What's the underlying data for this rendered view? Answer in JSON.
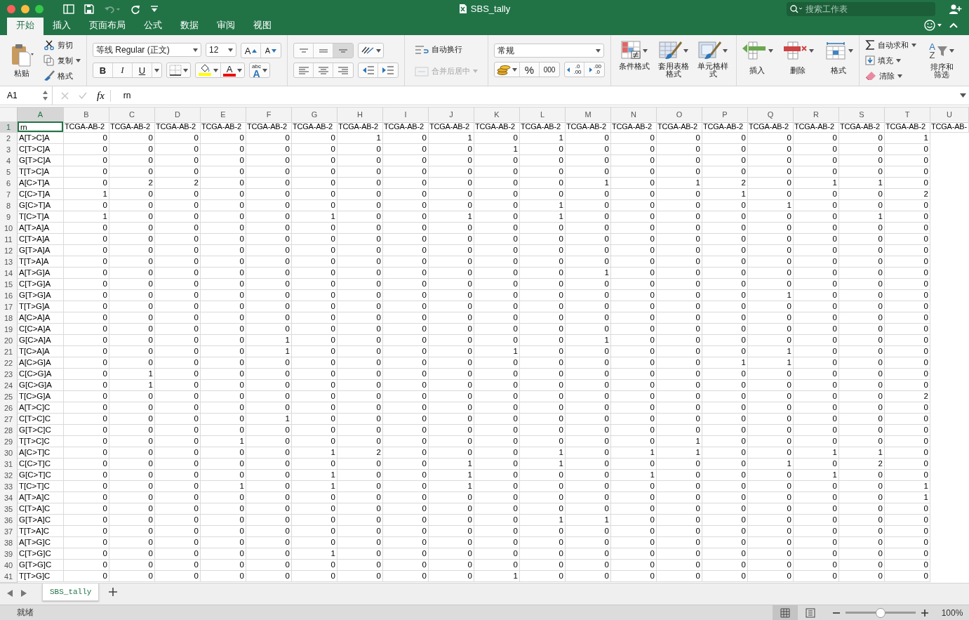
{
  "window": {
    "title": "SBS_tally"
  },
  "search": {
    "placeholder": "搜索工作表"
  },
  "ribbon_tabs": [
    {
      "label": "开始",
      "selected": true
    },
    {
      "label": "插入",
      "selected": false
    },
    {
      "label": "页面布局",
      "selected": false
    },
    {
      "label": "公式",
      "selected": false
    },
    {
      "label": "数据",
      "selected": false
    },
    {
      "label": "审阅",
      "selected": false
    },
    {
      "label": "视图",
      "selected": false
    }
  ],
  "clipboard": {
    "paste": "粘贴",
    "cut": "剪切",
    "copy": "复制",
    "format_painter": "格式"
  },
  "font": {
    "name": "等线 Regular (正文)",
    "size": "12",
    "grow": "A",
    "shrink": "A",
    "bold": "B",
    "italic": "I",
    "underline": "U",
    "font_color": "A",
    "phonetic_top": "abc",
    "phonetic_bottom": "A"
  },
  "vertical_align": [
    {
      "kind": "top",
      "selected": false
    },
    {
      "kind": "middle",
      "selected": false
    },
    {
      "kind": "bottom",
      "selected": true
    }
  ],
  "horizontal_align": [
    {
      "kind": "left",
      "selected": false
    },
    {
      "kind": "center",
      "selected": false
    },
    {
      "kind": "right",
      "selected": false
    }
  ],
  "wrap_text": {
    "label": "自动换行",
    "disabled": false
  },
  "merge_center": {
    "label": "合并后居中",
    "disabled": true
  },
  "number": {
    "format": "常规",
    "percent": "%",
    "comma": "000",
    "decimals": [
      {
        "top": ".0",
        "bottom": ".00"
      },
      {
        "top": ".00",
        "bottom": ".0"
      }
    ]
  },
  "styles": [
    {
      "kind": "conditional",
      "label": "条件格式"
    },
    {
      "kind": "table",
      "label": "套用表格格式"
    },
    {
      "kind": "cell",
      "label": "单元格样式"
    }
  ],
  "cells_group": [
    {
      "kind": "insert",
      "label": "插入"
    },
    {
      "kind": "delete",
      "label": "删除"
    },
    {
      "kind": "format",
      "label": "格式"
    }
  ],
  "editing": {
    "autosum": "自动求和",
    "fill": "填充",
    "clear": "清除",
    "sort": "排序和筛选",
    "sort_top": "A",
    "sort_bottom": "Z"
  },
  "formula_bar": {
    "cell_ref": "A1",
    "fx": "fx",
    "value": "rn"
  },
  "columns": [
    {
      "label": "A",
      "selected": true
    },
    {
      "label": "B",
      "selected": false
    },
    {
      "label": "C",
      "selected": false
    },
    {
      "label": "D",
      "selected": false
    },
    {
      "label": "E",
      "selected": false
    },
    {
      "label": "F",
      "selected": false
    },
    {
      "label": "G",
      "selected": false
    },
    {
      "label": "H",
      "selected": false
    },
    {
      "label": "I",
      "selected": false
    },
    {
      "label": "J",
      "selected": false
    },
    {
      "label": "K",
      "selected": false
    },
    {
      "label": "L",
      "selected": false
    },
    {
      "label": "M",
      "selected": false
    },
    {
      "label": "N",
      "selected": false
    },
    {
      "label": "O",
      "selected": false
    },
    {
      "label": "P",
      "selected": false
    },
    {
      "label": "Q",
      "selected": false
    },
    {
      "label": "R",
      "selected": false
    },
    {
      "label": "S",
      "selected": false
    },
    {
      "label": "T",
      "selected": false
    },
    {
      "label": "U",
      "selected": false
    }
  ],
  "rows": [
    {
      "number": "1",
      "selected": true,
      "kind": "header",
      "cells": [
        "rn",
        "TCGA-AB-2",
        "TCGA-AB-2",
        "TCGA-AB-2",
        "TCGA-AB-2",
        "TCGA-AB-2",
        "TCGA-AB-2",
        "TCGA-AB-2",
        "TCGA-AB-2",
        "TCGA-AB-2",
        "TCGA-AB-2",
        "TCGA-AB-2",
        "TCGA-AB-2",
        "TCGA-AB-2",
        "TCGA-AB-2",
        "TCGA-AB-2",
        "TCGA-AB-2",
        "TCGA-AB-2",
        "TCGA-AB-2",
        "TCGA-AB-2",
        "TCGA-AB-"
      ]
    },
    {
      "number": "2",
      "selected": false,
      "kind": "data",
      "cells": [
        "A[T>C]A",
        "0",
        "0",
        "0",
        "0",
        "0",
        "0",
        "1",
        "0",
        "1",
        "0",
        "1",
        "0",
        "0",
        "0",
        "0",
        "0",
        "0",
        "0",
        "1"
      ]
    },
    {
      "number": "3",
      "selected": false,
      "kind": "data",
      "cells": [
        "C[T>C]A",
        "0",
        "0",
        "0",
        "0",
        "0",
        "0",
        "0",
        "0",
        "0",
        "1",
        "0",
        "0",
        "0",
        "0",
        "0",
        "0",
        "0",
        "0",
        "0"
      ]
    },
    {
      "number": "4",
      "selected": false,
      "kind": "data",
      "cells": [
        "G[T>C]A",
        "0",
        "0",
        "0",
        "0",
        "0",
        "0",
        "0",
        "0",
        "0",
        "0",
        "0",
        "0",
        "0",
        "0",
        "0",
        "0",
        "0",
        "0",
        "0"
      ]
    },
    {
      "number": "5",
      "selected": false,
      "kind": "data",
      "cells": [
        "T[T>C]A",
        "0",
        "0",
        "0",
        "0",
        "0",
        "0",
        "0",
        "0",
        "0",
        "0",
        "0",
        "0",
        "0",
        "0",
        "0",
        "0",
        "0",
        "0",
        "0"
      ]
    },
    {
      "number": "6",
      "selected": false,
      "kind": "data",
      "cells": [
        "A[C>T]A",
        "0",
        "2",
        "2",
        "0",
        "0",
        "0",
        "0",
        "0",
        "0",
        "0",
        "0",
        "1",
        "0",
        "1",
        "2",
        "0",
        "1",
        "1",
        "0"
      ]
    },
    {
      "number": "7",
      "selected": false,
      "kind": "data",
      "cells": [
        "C[C>T]A",
        "1",
        "0",
        "0",
        "0",
        "0",
        "0",
        "0",
        "0",
        "0",
        "0",
        "0",
        "0",
        "0",
        "0",
        "1",
        "0",
        "0",
        "0",
        "2"
      ]
    },
    {
      "number": "8",
      "selected": false,
      "kind": "data",
      "cells": [
        "G[C>T]A",
        "0",
        "0",
        "0",
        "0",
        "0",
        "0",
        "0",
        "0",
        "0",
        "0",
        "1",
        "0",
        "0",
        "0",
        "0",
        "1",
        "0",
        "0",
        "0"
      ]
    },
    {
      "number": "9",
      "selected": false,
      "kind": "data",
      "cells": [
        "T[C>T]A",
        "1",
        "0",
        "0",
        "0",
        "0",
        "1",
        "0",
        "0",
        "1",
        "0",
        "1",
        "0",
        "0",
        "0",
        "0",
        "0",
        "0",
        "1",
        "0"
      ]
    },
    {
      "number": "10",
      "selected": false,
      "kind": "data",
      "cells": [
        "A[T>A]A",
        "0",
        "0",
        "0",
        "0",
        "0",
        "0",
        "0",
        "0",
        "0",
        "0",
        "0",
        "0",
        "0",
        "0",
        "0",
        "0",
        "0",
        "0",
        "0"
      ]
    },
    {
      "number": "11",
      "selected": false,
      "kind": "data",
      "cells": [
        "C[T>A]A",
        "0",
        "0",
        "0",
        "0",
        "0",
        "0",
        "0",
        "0",
        "0",
        "0",
        "0",
        "0",
        "0",
        "0",
        "0",
        "0",
        "0",
        "0",
        "0"
      ]
    },
    {
      "number": "12",
      "selected": false,
      "kind": "data",
      "cells": [
        "G[T>A]A",
        "0",
        "0",
        "0",
        "0",
        "0",
        "0",
        "0",
        "0",
        "0",
        "0",
        "0",
        "0",
        "0",
        "0",
        "0",
        "0",
        "0",
        "0",
        "0"
      ]
    },
    {
      "number": "13",
      "selected": false,
      "kind": "data",
      "cells": [
        "T[T>A]A",
        "0",
        "0",
        "0",
        "0",
        "0",
        "0",
        "0",
        "0",
        "0",
        "0",
        "0",
        "0",
        "0",
        "0",
        "0",
        "0",
        "0",
        "0",
        "0"
      ]
    },
    {
      "number": "14",
      "selected": false,
      "kind": "data",
      "cells": [
        "A[T>G]A",
        "0",
        "0",
        "0",
        "0",
        "0",
        "0",
        "0",
        "0",
        "0",
        "0",
        "0",
        "1",
        "0",
        "0",
        "0",
        "0",
        "0",
        "0",
        "0"
      ]
    },
    {
      "number": "15",
      "selected": false,
      "kind": "data",
      "cells": [
        "C[T>G]A",
        "0",
        "0",
        "0",
        "0",
        "0",
        "0",
        "0",
        "0",
        "0",
        "0",
        "0",
        "0",
        "0",
        "0",
        "0",
        "0",
        "0",
        "0",
        "0"
      ]
    },
    {
      "number": "16",
      "selected": false,
      "kind": "data",
      "cells": [
        "G[T>G]A",
        "0",
        "0",
        "0",
        "0",
        "0",
        "0",
        "0",
        "0",
        "0",
        "0",
        "0",
        "0",
        "0",
        "0",
        "0",
        "1",
        "0",
        "0",
        "0"
      ]
    },
    {
      "number": "17",
      "selected": false,
      "kind": "data",
      "cells": [
        "T[T>G]A",
        "0",
        "0",
        "0",
        "0",
        "0",
        "0",
        "0",
        "0",
        "0",
        "0",
        "0",
        "0",
        "0",
        "0",
        "0",
        "0",
        "0",
        "0",
        "0"
      ]
    },
    {
      "number": "18",
      "selected": false,
      "kind": "data",
      "cells": [
        "A[C>A]A",
        "0",
        "0",
        "0",
        "0",
        "0",
        "0",
        "0",
        "0",
        "0",
        "0",
        "0",
        "0",
        "0",
        "0",
        "0",
        "0",
        "0",
        "0",
        "0"
      ]
    },
    {
      "number": "19",
      "selected": false,
      "kind": "data",
      "cells": [
        "C[C>A]A",
        "0",
        "0",
        "0",
        "0",
        "0",
        "0",
        "0",
        "0",
        "0",
        "0",
        "0",
        "0",
        "0",
        "0",
        "0",
        "0",
        "0",
        "0",
        "0"
      ]
    },
    {
      "number": "20",
      "selected": false,
      "kind": "data",
      "cells": [
        "G[C>A]A",
        "0",
        "0",
        "0",
        "0",
        "1",
        "0",
        "0",
        "0",
        "0",
        "0",
        "0",
        "1",
        "0",
        "0",
        "0",
        "0",
        "0",
        "0",
        "0"
      ]
    },
    {
      "number": "21",
      "selected": false,
      "kind": "data",
      "cells": [
        "T[C>A]A",
        "0",
        "0",
        "0",
        "0",
        "1",
        "0",
        "0",
        "0",
        "0",
        "1",
        "0",
        "0",
        "0",
        "0",
        "0",
        "1",
        "0",
        "0",
        "0"
      ]
    },
    {
      "number": "22",
      "selected": false,
      "kind": "data",
      "cells": [
        "A[C>G]A",
        "0",
        "0",
        "0",
        "0",
        "0",
        "0",
        "0",
        "0",
        "0",
        "0",
        "0",
        "0",
        "0",
        "0",
        "1",
        "1",
        "0",
        "0",
        "0"
      ]
    },
    {
      "number": "23",
      "selected": false,
      "kind": "data",
      "cells": [
        "C[C>G]A",
        "0",
        "1",
        "0",
        "0",
        "0",
        "0",
        "0",
        "0",
        "0",
        "0",
        "0",
        "0",
        "0",
        "0",
        "0",
        "0",
        "0",
        "0",
        "0"
      ]
    },
    {
      "number": "24",
      "selected": false,
      "kind": "data",
      "cells": [
        "G[C>G]A",
        "0",
        "1",
        "0",
        "0",
        "0",
        "0",
        "0",
        "0",
        "0",
        "0",
        "0",
        "0",
        "0",
        "0",
        "0",
        "0",
        "0",
        "0",
        "0"
      ]
    },
    {
      "number": "25",
      "selected": false,
      "kind": "data",
      "cells": [
        "T[C>G]A",
        "0",
        "0",
        "0",
        "0",
        "0",
        "0",
        "0",
        "0",
        "0",
        "0",
        "0",
        "0",
        "0",
        "0",
        "0",
        "0",
        "0",
        "0",
        "2"
      ]
    },
    {
      "number": "26",
      "selected": false,
      "kind": "data",
      "cells": [
        "A[T>C]C",
        "0",
        "0",
        "0",
        "0",
        "0",
        "0",
        "0",
        "0",
        "0",
        "0",
        "0",
        "0",
        "0",
        "0",
        "0",
        "0",
        "0",
        "0",
        "0"
      ]
    },
    {
      "number": "27",
      "selected": false,
      "kind": "data",
      "cells": [
        "C[T>C]C",
        "0",
        "0",
        "0",
        "0",
        "1",
        "0",
        "0",
        "0",
        "0",
        "0",
        "0",
        "0",
        "0",
        "0",
        "0",
        "0",
        "0",
        "0",
        "0"
      ]
    },
    {
      "number": "28",
      "selected": false,
      "kind": "data",
      "cells": [
        "G[T>C]C",
        "0",
        "0",
        "0",
        "0",
        "0",
        "0",
        "0",
        "0",
        "0",
        "0",
        "0",
        "0",
        "0",
        "0",
        "0",
        "0",
        "0",
        "0",
        "0"
      ]
    },
    {
      "number": "29",
      "selected": false,
      "kind": "data",
      "cells": [
        "T[T>C]C",
        "0",
        "0",
        "0",
        "1",
        "0",
        "0",
        "0",
        "0",
        "0",
        "0",
        "0",
        "0",
        "0",
        "1",
        "0",
        "0",
        "0",
        "0",
        "0"
      ]
    },
    {
      "number": "30",
      "selected": false,
      "kind": "data",
      "cells": [
        "A[C>T]C",
        "0",
        "0",
        "0",
        "0",
        "0",
        "1",
        "2",
        "0",
        "0",
        "0",
        "1",
        "0",
        "1",
        "1",
        "0",
        "0",
        "1",
        "1",
        "0"
      ]
    },
    {
      "number": "31",
      "selected": false,
      "kind": "data",
      "cells": [
        "C[C>T]C",
        "0",
        "0",
        "0",
        "0",
        "0",
        "0",
        "0",
        "0",
        "1",
        "0",
        "1",
        "0",
        "0",
        "0",
        "0",
        "1",
        "0",
        "2",
        "0"
      ]
    },
    {
      "number": "32",
      "selected": false,
      "kind": "data",
      "cells": [
        "G[C>T]C",
        "0",
        "0",
        "0",
        "0",
        "0",
        "1",
        "0",
        "0",
        "1",
        "0",
        "0",
        "0",
        "1",
        "0",
        "0",
        "0",
        "1",
        "0",
        "0"
      ]
    },
    {
      "number": "33",
      "selected": false,
      "kind": "data",
      "cells": [
        "T[C>T]C",
        "0",
        "0",
        "0",
        "1",
        "0",
        "1",
        "0",
        "0",
        "1",
        "0",
        "0",
        "0",
        "0",
        "0",
        "0",
        "0",
        "0",
        "0",
        "1"
      ]
    },
    {
      "number": "34",
      "selected": false,
      "kind": "data",
      "cells": [
        "A[T>A]C",
        "0",
        "0",
        "0",
        "0",
        "0",
        "0",
        "0",
        "0",
        "0",
        "0",
        "0",
        "0",
        "0",
        "0",
        "0",
        "0",
        "0",
        "0",
        "1"
      ]
    },
    {
      "number": "35",
      "selected": false,
      "kind": "data",
      "cells": [
        "C[T>A]C",
        "0",
        "0",
        "0",
        "0",
        "0",
        "0",
        "0",
        "0",
        "0",
        "0",
        "0",
        "0",
        "0",
        "0",
        "0",
        "0",
        "0",
        "0",
        "0"
      ]
    },
    {
      "number": "36",
      "selected": false,
      "kind": "data",
      "cells": [
        "G[T>A]C",
        "0",
        "0",
        "0",
        "0",
        "0",
        "0",
        "0",
        "0",
        "0",
        "0",
        "1",
        "1",
        "0",
        "0",
        "0",
        "0",
        "0",
        "0",
        "0"
      ]
    },
    {
      "number": "37",
      "selected": false,
      "kind": "data",
      "cells": [
        "T[T>A]C",
        "0",
        "0",
        "0",
        "0",
        "0",
        "0",
        "0",
        "0",
        "0",
        "0",
        "0",
        "0",
        "0",
        "0",
        "0",
        "0",
        "0",
        "0",
        "0"
      ]
    },
    {
      "number": "38",
      "selected": false,
      "kind": "data",
      "cells": [
        "A[T>G]C",
        "0",
        "0",
        "0",
        "0",
        "0",
        "0",
        "0",
        "0",
        "0",
        "0",
        "0",
        "0",
        "0",
        "0",
        "0",
        "0",
        "0",
        "0",
        "0"
      ]
    },
    {
      "number": "39",
      "selected": false,
      "kind": "data",
      "cells": [
        "C[T>G]C",
        "0",
        "0",
        "0",
        "0",
        "0",
        "1",
        "0",
        "0",
        "0",
        "0",
        "0",
        "0",
        "0",
        "0",
        "0",
        "0",
        "0",
        "0",
        "0"
      ]
    },
    {
      "number": "40",
      "selected": false,
      "kind": "data",
      "cells": [
        "G[T>G]C",
        "0",
        "0",
        "0",
        "0",
        "0",
        "0",
        "0",
        "0",
        "0",
        "0",
        "0",
        "0",
        "0",
        "0",
        "0",
        "0",
        "0",
        "0",
        "0"
      ]
    },
    {
      "number": "41",
      "selected": false,
      "kind": "data",
      "cells": [
        "T[T>G]C",
        "0",
        "0",
        "0",
        "0",
        "0",
        "0",
        "0",
        "0",
        "0",
        "1",
        "0",
        "0",
        "0",
        "0",
        "0",
        "0",
        "0",
        "0",
        "0"
      ]
    }
  ],
  "sheet_tabs": [
    {
      "label": "SBS_tally",
      "selected": true
    }
  ],
  "status_bar": {
    "status": "就绪",
    "views": [
      {
        "kind": "normal",
        "selected": true
      },
      {
        "kind": "page_layout",
        "selected": false
      }
    ],
    "zoom": {
      "level": 0.5
    },
    "zoom_label": "100%"
  }
}
